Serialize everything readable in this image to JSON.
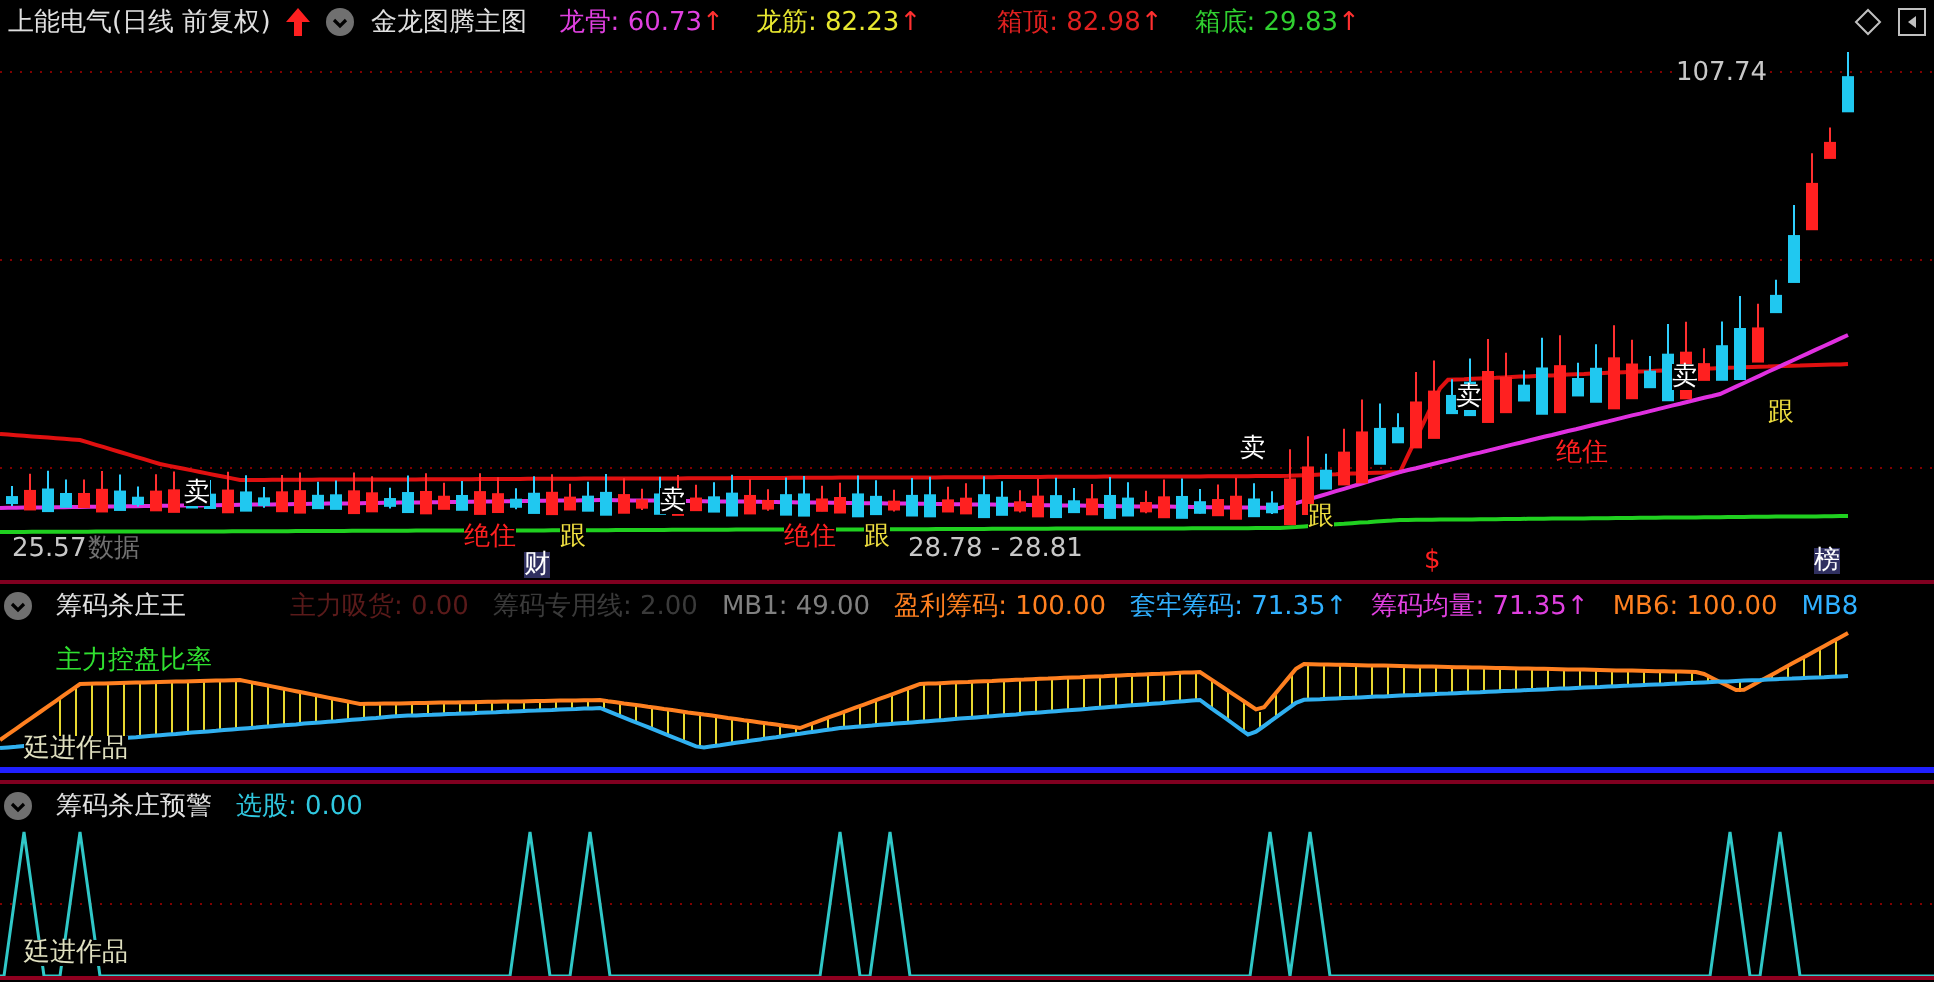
{
  "main_panel": {
    "title": "上能电气(日线 前复权)",
    "indicator_name": "金龙图腾主图",
    "readings": [
      {
        "label": "龙骨:",
        "value": "60.73",
        "arrow": "↑",
        "color": "#e040e0"
      },
      {
        "label": "龙筋:",
        "value": "82.23",
        "arrow": "↑",
        "color": "#e8e830"
      },
      {
        "label": "箱顶:",
        "value": "82.98",
        "arrow": "↑",
        "color": "#e02020"
      },
      {
        "label": "箱底:",
        "value": "29.83",
        "arrow": "↑",
        "color": "#30d030"
      }
    ],
    "labels": [
      {
        "text": "107.74",
        "kind": "price"
      },
      {
        "text": "25.57",
        "kind": "price"
      },
      {
        "text": "数据",
        "kind": "dim"
      },
      {
        "text": "卖",
        "kind": "sell"
      },
      {
        "text": "卖",
        "kind": "sell"
      },
      {
        "text": "卖",
        "kind": "sell"
      },
      {
        "text": "卖",
        "kind": "sell"
      },
      {
        "text": "卖",
        "kind": "sell"
      },
      {
        "text": "跟",
        "kind": "follow"
      },
      {
        "text": "跟",
        "kind": "follow"
      },
      {
        "text": "跟",
        "kind": "follow"
      },
      {
        "text": "跟",
        "kind": "follow"
      },
      {
        "text": "绝住",
        "kind": "hold"
      },
      {
        "text": "绝住",
        "kind": "hold"
      },
      {
        "text": "绝住",
        "kind": "hold"
      },
      {
        "text": "财",
        "kind": "tag"
      },
      {
        "text": "28.78 - 28.81",
        "kind": "price"
      },
      {
        "text": "$",
        "kind": "hold"
      },
      {
        "text": "榜",
        "kind": "tag"
      }
    ]
  },
  "chip_panel": {
    "title": "筹码杀庄王",
    "readings": [
      {
        "text": "主力吸货: 0.00",
        "color": "#5a1a1a"
      },
      {
        "text": "筹码专用线: 2.00",
        "color": "#3a3a3a"
      },
      {
        "text": "MB1: 49.00",
        "color": "#808080"
      },
      {
        "text": "盈利筹码: 100.00",
        "color": "#ff8020"
      },
      {
        "text": "套牢筹码: 71.35↑",
        "color": "#30b0ff"
      },
      {
        "text": "筹码均量: 71.35↑",
        "color": "#e040e0"
      },
      {
        "text": "MB6: 100.00",
        "color": "#ff8020"
      },
      {
        "text": "MB8",
        "color": "#30b0ff"
      }
    ],
    "overlay_text": "主力控盘比率",
    "credit": "廷进作品"
  },
  "alert_panel": {
    "title": "筹码杀庄预警",
    "reading": "选股: 0.00",
    "credit": "廷进作品"
  }
}
